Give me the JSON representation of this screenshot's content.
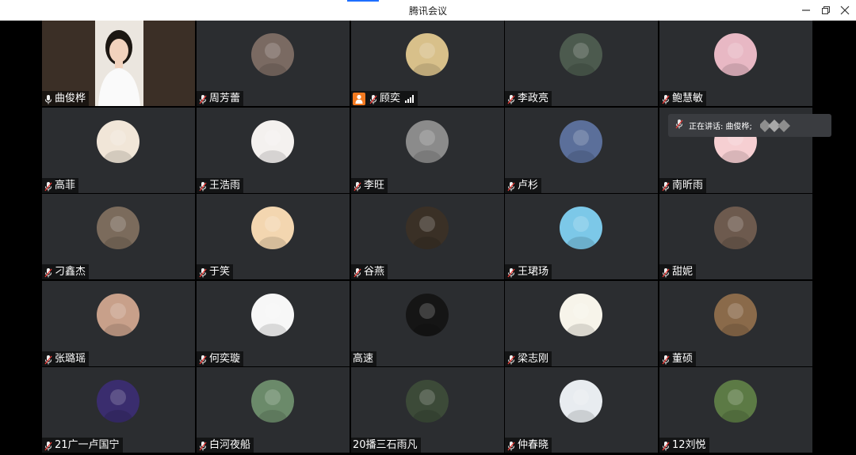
{
  "window": {
    "title": "腾讯会议",
    "minimize_icon": "minimize-icon",
    "restore_icon": "restore-icon",
    "close_icon": "close-icon"
  },
  "speaker_popup": {
    "text": "正在讲话: 曲俊桦;"
  },
  "participants": [
    {
      "name": "曲俊桦",
      "mic": "on",
      "video": true
    },
    {
      "name": "周芳蕾",
      "mic": "muted",
      "avatar": "#7a6a62"
    },
    {
      "name": "顾奕",
      "mic": "muted",
      "avatar": "#d8c08a",
      "host": true,
      "signal": true
    },
    {
      "name": "李政亮",
      "mic": "muted",
      "avatar": "#4c5a4e"
    },
    {
      "name": "鲍慧敏",
      "mic": "muted",
      "avatar": "#e8b8c4"
    },
    {
      "name": "高菲",
      "mic": "muted",
      "avatar": "#f1e6d8"
    },
    {
      "name": "王浩雨",
      "mic": "muted",
      "avatar": "#f4f1ef"
    },
    {
      "name": "李旺",
      "mic": "muted",
      "avatar": "#8b8b8b"
    },
    {
      "name": "卢杉",
      "mic": "muted",
      "avatar": "#5b6f9a"
    },
    {
      "name": "南昕雨",
      "mic": "muted",
      "avatar": "#f6cfd2"
    },
    {
      "name": "刁鑫杰",
      "mic": "muted",
      "avatar": "#7b6b5c"
    },
    {
      "name": "于笑",
      "mic": "muted",
      "avatar": "#f3d6b0"
    },
    {
      "name": "谷燕",
      "mic": "muted",
      "avatar": "#3a3026"
    },
    {
      "name": "王珺玚",
      "mic": "muted",
      "avatar": "#7cc8e8"
    },
    {
      "name": "甜妮",
      "mic": "muted",
      "avatar": "#6d5a4e"
    },
    {
      "name": "张璐瑶",
      "mic": "muted",
      "avatar": "#c8a08a"
    },
    {
      "name": "何奕璇",
      "mic": "muted",
      "avatar": "#f7f7f7"
    },
    {
      "name": "高速",
      "mic": "none",
      "avatar": "#151515"
    },
    {
      "name": "梁志刚",
      "mic": "muted",
      "avatar": "#f7f4ea"
    },
    {
      "name": "董硕",
      "mic": "muted",
      "avatar": "#8a6a4a"
    },
    {
      "name": "21广一卢国宁",
      "mic": "muted",
      "avatar": "#3a2d6e"
    },
    {
      "name": "白河夜船",
      "mic": "muted",
      "avatar": "#6b8a6a"
    },
    {
      "name": "20播三石雨凡",
      "mic": "none",
      "avatar": "#3c4a38"
    },
    {
      "name": "仲春晓",
      "mic": "muted",
      "avatar": "#e8ecf0"
    },
    {
      "name": "12刘悦",
      "mic": "muted",
      "avatar": "#5c7a45"
    }
  ]
}
